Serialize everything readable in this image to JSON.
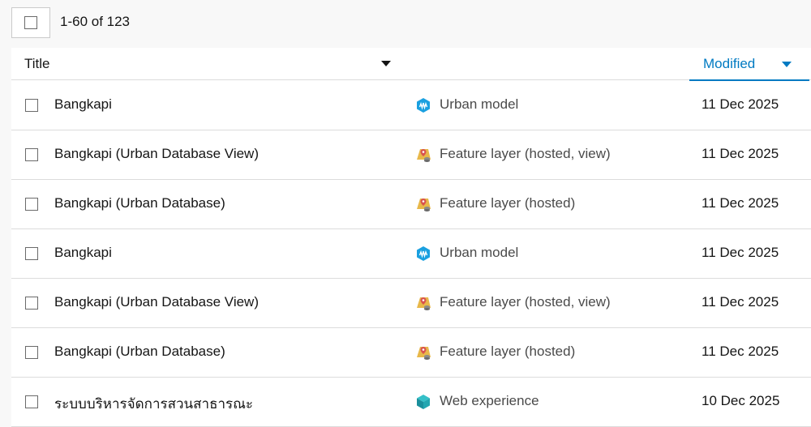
{
  "toolbar": {
    "count_label": "1-60 of 123"
  },
  "header": {
    "title_label": "Title",
    "modified_label": "Modified"
  },
  "colors": {
    "accent": "#007ac2",
    "urban_model": "#1aa0e0",
    "feature_layer": "#e8b84a"
  },
  "rows": [
    {
      "title": "Bangkapi",
      "type": "Urban model",
      "icon": "urban-model-icon",
      "modified": "11 Dec 2025"
    },
    {
      "title": "Bangkapi (Urban Database View)",
      "type": "Feature layer (hosted, view)",
      "icon": "feature-layer-icon",
      "modified": "11 Dec 2025"
    },
    {
      "title": "Bangkapi (Urban Database)",
      "type": "Feature layer (hosted)",
      "icon": "feature-layer-icon",
      "modified": "11 Dec 2025"
    },
    {
      "title": "Bangkapi",
      "type": "Urban model",
      "icon": "urban-model-icon",
      "modified": "11 Dec 2025"
    },
    {
      "title": "Bangkapi (Urban Database View)",
      "type": "Feature layer (hosted, view)",
      "icon": "feature-layer-icon",
      "modified": "11 Dec 2025"
    },
    {
      "title": "Bangkapi (Urban Database)",
      "type": "Feature layer (hosted)",
      "icon": "feature-layer-icon",
      "modified": "11 Dec 2025"
    },
    {
      "title": "ระบบบริหารจัดการสวนสาธารณะ",
      "type": "Web experience",
      "icon": "web-experience-icon",
      "modified": "10 Dec 2025"
    }
  ]
}
